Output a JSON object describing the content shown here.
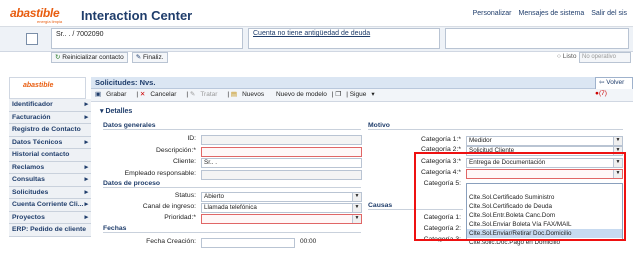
{
  "header": {
    "logo": "abastible",
    "logo_tagline": "energía limpia",
    "app_title": "Interaction Center",
    "links": [
      "Personalizar",
      "Mensajes de sistema",
      "Salir del sis"
    ]
  },
  "context": {
    "contact_text": "Sr.. . / 7002090",
    "seniority_link": "Cuenta no tiene antigüedad de deuda",
    "reset_button": "Reinicializar contacto",
    "finalize_button": "Finaliz.",
    "status_label": "Listo",
    "status_select": "No operativo"
  },
  "sidebar": {
    "logo": "abastible",
    "items": [
      {
        "label": "Identificador",
        "arrow": "▸"
      },
      {
        "label": "Facturación",
        "arrow": "▸"
      },
      {
        "label": "Registro de Contacto",
        "arrow": ""
      },
      {
        "label": "Datos Técnicos",
        "arrow": "▸"
      },
      {
        "label": "Historial contacto",
        "arrow": ""
      },
      {
        "label": "Reclamos",
        "arrow": "▸"
      },
      {
        "label": "Consultas",
        "arrow": "▸"
      },
      {
        "label": "Solicitudes",
        "arrow": "▸"
      },
      {
        "label": "Cuenta Corriente Cli...",
        "arrow": "▸"
      },
      {
        "label": "Proyectos",
        "arrow": "▸"
      },
      {
        "label": "ERP: Pedido de cliente",
        "arrow": ""
      }
    ]
  },
  "panel": {
    "title": "Solicitudes: Nvs.",
    "back_button": "Volver",
    "alerts": "(7)",
    "actions": [
      "Grabar",
      "Cancelar",
      "Tratar",
      "Nuevos",
      "Nuevo de modelo",
      "Sigue"
    ],
    "details_label": "Detalles"
  },
  "general": {
    "title": "Datos generales",
    "fields": [
      {
        "label": "ID:",
        "value": ""
      },
      {
        "label": "Descripción:*",
        "value": ""
      },
      {
        "label": "Cliente:",
        "value": "Sr.. ."
      },
      {
        "label": "Empleado responsable:",
        "value": ""
      }
    ]
  },
  "process": {
    "title": "Datos de proceso",
    "fields": [
      {
        "label": "Status:",
        "value": "Abierto"
      },
      {
        "label": "Canal de ingreso:",
        "value": "Llamada telefónica"
      },
      {
        "label": "Prioridad:*",
        "value": ""
      }
    ]
  },
  "dates": {
    "title": "Fechas",
    "first_label": "Fecha Creación:",
    "first_value": "00:00"
  },
  "motivo": {
    "title": "Motivo",
    "fields": [
      {
        "label": "Categoría 1:*",
        "value": "Medidor"
      },
      {
        "label": "Categoría 2:*",
        "value": "Solicitud Cliente"
      },
      {
        "label": "Categoría 3:*",
        "value": "Entrega de Documentación"
      },
      {
        "label": "Categoría 4:*",
        "value": ""
      },
      {
        "label": "Categoría 5:",
        "value": ""
      }
    ]
  },
  "causas": {
    "title": "Causas",
    "fields": [
      {
        "label": "Categoría 1:",
        "value": ""
      },
      {
        "label": "Categoría 2:",
        "value": ""
      },
      {
        "label": "Categoría 3:",
        "value": ""
      }
    ]
  },
  "dropdown": {
    "options": [
      "",
      "Clte.Sol.Certificado Suministro",
      "Clte.Sol.Certificado de Deuda",
      "Clte.Sol.Entr.Boleta Canc.Dom",
      "Clte.Sol.Enviar Boleta Vía FAX/MAIL",
      "Clte.Sol.Enviar/Retirar Doc.Domicilio",
      "Clte.solic.Doc.Pago en Domicilio"
    ],
    "selected_index": 5
  },
  "colors": {
    "brand": "#e85d10",
    "accent": "#1f3d6b",
    "highlight": "#e11111",
    "required": "#e06666"
  }
}
